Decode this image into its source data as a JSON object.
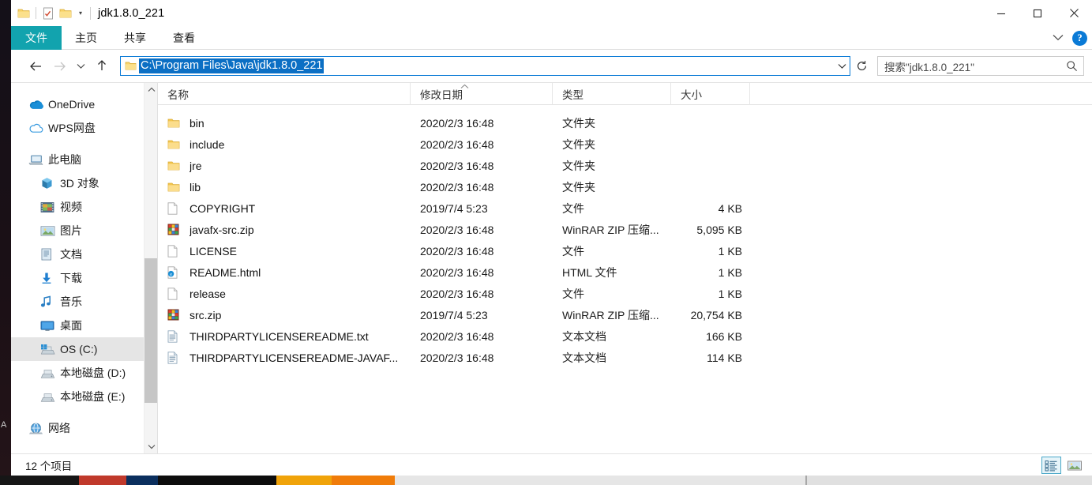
{
  "window": {
    "title": "jdk1.8.0_221",
    "quick_access": [
      {
        "name": "folder-icon",
        "label": "folder"
      },
      {
        "name": "properties-icon",
        "label": "properties"
      },
      {
        "name": "new-folder-icon",
        "label": "new folder"
      },
      {
        "name": "customize-caret-icon",
        "label": "customize quick access toolbar"
      }
    ],
    "controls": {
      "minimize": "minimize",
      "maximize": "maximize",
      "close": "close"
    }
  },
  "ribbon": {
    "tabs": [
      {
        "label": "文件",
        "active": true
      },
      {
        "label": "主页",
        "active": false
      },
      {
        "label": "共享",
        "active": false
      },
      {
        "label": "查看",
        "active": false
      }
    ],
    "collapse_icon": "chevron-down-icon",
    "help_label": "?"
  },
  "navigation": {
    "back_icon": "arrow-left-icon",
    "forward_icon": "arrow-right-icon",
    "recent_icon": "chevron-down-icon",
    "up_icon": "arrow-up-icon",
    "address": {
      "value": "C:\\Program Files\\Java\\jdk1.8.0_221",
      "selected": true,
      "dropdown_icon": "chevron-down-icon"
    },
    "refresh_icon": "refresh-icon",
    "search": {
      "placeholder": "搜索\"jdk1.8.0_221\"",
      "value": "",
      "icon": "search-icon"
    }
  },
  "sidebar": {
    "items": [
      {
        "label": "OneDrive",
        "icon": "onedrive-cloud-icon",
        "level": 0,
        "selected": false
      },
      {
        "label": "WPS网盘",
        "icon": "wps-cloud-icon",
        "level": 0,
        "selected": false
      },
      {
        "label": "此电脑",
        "icon": "this-pc-icon",
        "level": 0,
        "selected": false
      },
      {
        "label": "3D 对象",
        "icon": "3d-objects-icon",
        "level": 1,
        "selected": false
      },
      {
        "label": "视频",
        "icon": "videos-icon",
        "level": 1,
        "selected": false
      },
      {
        "label": "图片",
        "icon": "pictures-icon",
        "level": 1,
        "selected": false
      },
      {
        "label": "文档",
        "icon": "documents-icon",
        "level": 1,
        "selected": false
      },
      {
        "label": "下载",
        "icon": "downloads-icon",
        "level": 1,
        "selected": false
      },
      {
        "label": "音乐",
        "icon": "music-icon",
        "level": 1,
        "selected": false
      },
      {
        "label": "桌面",
        "icon": "desktop-icon",
        "level": 1,
        "selected": false
      },
      {
        "label": "OS (C:)",
        "icon": "os-drive-icon",
        "level": 1,
        "selected": true
      },
      {
        "label": "本地磁盘 (D:)",
        "icon": "drive-icon",
        "level": 1,
        "selected": false
      },
      {
        "label": "本地磁盘 (E:)",
        "icon": "drive-icon",
        "level": 1,
        "selected": false
      },
      {
        "label": "网络",
        "icon": "network-icon",
        "level": 0,
        "selected": false
      }
    ],
    "scrollbar": {
      "up_icon": "chevron-up-icon",
      "down_icon": "chevron-down-icon"
    }
  },
  "file_list": {
    "columns": [
      {
        "key": "name",
        "label": "名称"
      },
      {
        "key": "date",
        "label": "修改日期"
      },
      {
        "key": "type",
        "label": "类型"
      },
      {
        "key": "size",
        "label": "大小"
      }
    ],
    "sort_indicator": "ascending-caret",
    "rows": [
      {
        "name": "bin",
        "date": "2020/2/3 16:48",
        "type": "文件夹",
        "size": "",
        "icon": "folder-icon"
      },
      {
        "name": "include",
        "date": "2020/2/3 16:48",
        "type": "文件夹",
        "size": "",
        "icon": "folder-icon"
      },
      {
        "name": "jre",
        "date": "2020/2/3 16:48",
        "type": "文件夹",
        "size": "",
        "icon": "folder-icon"
      },
      {
        "name": "lib",
        "date": "2020/2/3 16:48",
        "type": "文件夹",
        "size": "",
        "icon": "folder-icon"
      },
      {
        "name": "COPYRIGHT",
        "date": "2019/7/4 5:23",
        "type": "文件",
        "size": "4 KB",
        "icon": "blank-file-icon"
      },
      {
        "name": "javafx-src.zip",
        "date": "2020/2/3 16:48",
        "type": "WinRAR ZIP 压缩...",
        "size": "5,095 KB",
        "icon": "winrar-zip-icon"
      },
      {
        "name": "LICENSE",
        "date": "2020/2/3 16:48",
        "type": "文件",
        "size": "1 KB",
        "icon": "blank-file-icon"
      },
      {
        "name": "README.html",
        "date": "2020/2/3 16:48",
        "type": "HTML 文件",
        "size": "1 KB",
        "icon": "html-file-icon"
      },
      {
        "name": "release",
        "date": "2020/2/3 16:48",
        "type": "文件",
        "size": "1 KB",
        "icon": "blank-file-icon"
      },
      {
        "name": "src.zip",
        "date": "2019/7/4 5:23",
        "type": "WinRAR ZIP 压缩...",
        "size": "20,754 KB",
        "icon": "winrar-zip-icon"
      },
      {
        "name": "THIRDPARTYLICENSEREADME.txt",
        "date": "2020/2/3 16:48",
        "type": "文本文档",
        "size": "166 KB",
        "icon": "text-file-icon"
      },
      {
        "name": "THIRDPARTYLICENSEREADME-JAVAF...",
        "date": "2020/2/3 16:48",
        "type": "文本文档",
        "size": "114 KB",
        "icon": "text-file-icon"
      }
    ]
  },
  "status": {
    "item_count": "12 个项目",
    "views": [
      {
        "name": "details-view-button",
        "active": true
      },
      {
        "name": "large-icons-view-button",
        "active": false
      }
    ]
  },
  "desktop": {
    "stray_letter": "A"
  },
  "colors": {
    "file_tab": "#12a3ae",
    "selection": "#0b6fc4",
    "address_border": "#0a7ad6",
    "help_button": "#0a7ad6",
    "sidebar_selected": "#e5e5e5",
    "folder": "#f7d269"
  }
}
